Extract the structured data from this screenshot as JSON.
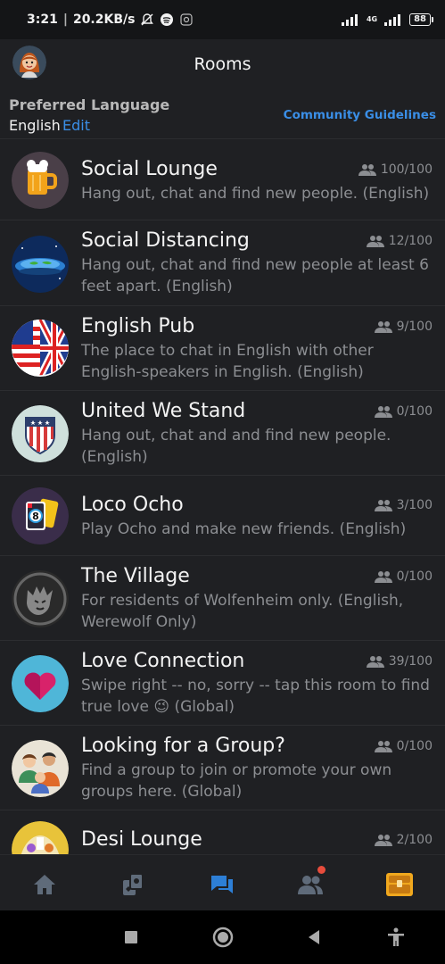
{
  "status_bar": {
    "time": "3:21",
    "speed": "20.2KB/s",
    "battery": "88",
    "network": "4G"
  },
  "header": {
    "title": "Rooms"
  },
  "language": {
    "heading": "Preferred Language",
    "value": "English",
    "edit": "Edit",
    "guidelines": "Community Guidelines"
  },
  "rooms": [
    {
      "name": "Social Lounge",
      "desc": "Hang out, chat and find new people. (English)",
      "count": "100/100",
      "icon": "beer-mug-icon"
    },
    {
      "name": "Social Distancing",
      "desc": "Hang out, chat and find new people at least 6 feet apart. (English)",
      "count": "12/100",
      "icon": "flat-earth-icon"
    },
    {
      "name": "English Pub",
      "desc": "The place to chat in English with other English-speakers in English. (English)",
      "count": "9/100",
      "icon": "us-uk-flag-icon"
    },
    {
      "name": "United We Stand",
      "desc": "Hang out, chat and and find new people. (English)",
      "count": "0/100",
      "icon": "shield-flag-icon"
    },
    {
      "name": "Loco Ocho",
      "desc": "Play Ocho and make new friends. (English)",
      "count": "3/100",
      "icon": "ocho-cards-icon"
    },
    {
      "name": "The Village",
      "desc": "For residents of Wolfenheim only. (English, Werewolf Only)",
      "count": "0/100",
      "icon": "werewolf-icon"
    },
    {
      "name": "Love Connection",
      "desc": "Swipe right -- no, sorry -- tap this room to find true love 😉 (Global)",
      "count": "39/100",
      "icon": "heart-icon"
    },
    {
      "name": "Looking for a Group?",
      "desc": "Find a group to join or promote your own groups here. (Global)",
      "count": "0/100",
      "icon": "group-people-icon"
    },
    {
      "name": "Desi Lounge",
      "desc": "",
      "count": "2/100",
      "icon": "desi-lounge-icon"
    }
  ],
  "nav": [
    "home-icon",
    "games-icon",
    "chat-icon",
    "friends-icon",
    "treasure-icon"
  ],
  "colors": {
    "accent": "#3a8ee6",
    "background": "#1f2023",
    "muted": "#8c8e92",
    "notification": "#e74c3c"
  }
}
